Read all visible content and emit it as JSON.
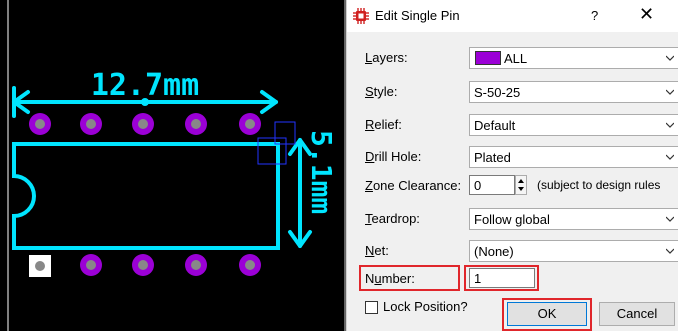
{
  "pcb": {
    "width_label": "12.7mm",
    "height_label": "5.1mm"
  },
  "dialog": {
    "title": "Edit Single Pin",
    "help": "?",
    "close": "✕",
    "fields": {
      "layers": {
        "label_key": "L",
        "label_rest": "ayers:",
        "value": "ALL",
        "swatch_color": "#9b00d6"
      },
      "style": {
        "label_key": "S",
        "label_rest": "tyle:",
        "value": "S-50-25"
      },
      "relief": {
        "label_key": "R",
        "label_rest": "elief:",
        "value": "Default"
      },
      "drill_hole": {
        "label_key": "D",
        "label_rest": "rill Hole:",
        "value": "Plated"
      },
      "zone_clearance": {
        "label_key": "Z",
        "label_rest": "one Clearance:",
        "value": "0",
        "note": "(subject to design rules"
      },
      "teardrop": {
        "label_key": "T",
        "label_rest": "eardrop:",
        "value": "Follow global"
      },
      "net": {
        "label_key": "N",
        "label_rest": "et:",
        "value": "(None)"
      },
      "number": {
        "label_key": "u",
        "label_pre": "N",
        "label_rest": "mber:",
        "value": "1"
      }
    },
    "lock_position_label": "Lock Position?",
    "ok_label": "OK",
    "cancel_label": "Cancel"
  },
  "colors": {
    "pcb_background": "#000000",
    "silkscreen": "#00e5ff",
    "pad": "#9b00d6",
    "highlight": "#e0262b"
  }
}
